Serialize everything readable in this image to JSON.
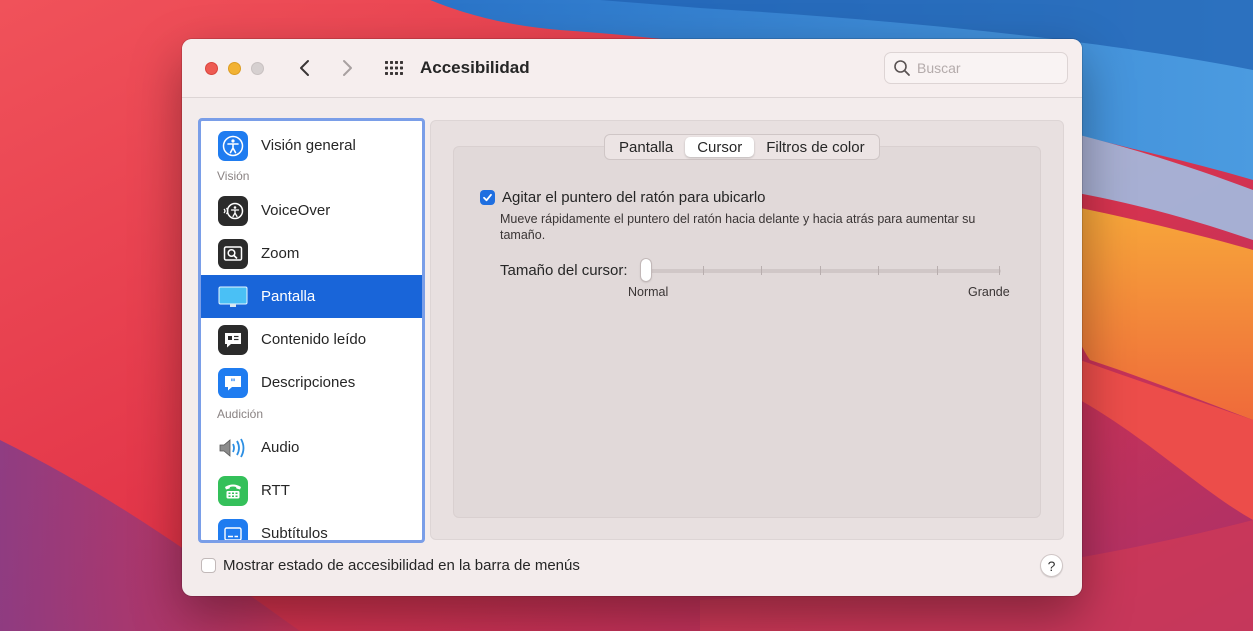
{
  "window": {
    "title": "Accesibilidad",
    "search_placeholder": "Buscar"
  },
  "sidebar": {
    "items": [
      {
        "label": "Visión general",
        "icon": "accessibility-icon"
      },
      {
        "label": "VoiceOver",
        "icon": "voiceover-icon"
      },
      {
        "label": "Zoom",
        "icon": "zoom-icon"
      },
      {
        "label": "Pantalla",
        "icon": "display-icon",
        "selected": true
      },
      {
        "label": "Contenido leído",
        "icon": "spoken-content-icon"
      },
      {
        "label": "Descripciones",
        "icon": "descriptions-icon"
      },
      {
        "label": "Audio",
        "icon": "speaker-icon"
      },
      {
        "label": "RTT",
        "icon": "rtt-phone-icon"
      },
      {
        "label": "Subtítulos",
        "icon": "subtitles-icon"
      }
    ],
    "sections": {
      "vision": "Visión",
      "audicion": "Audición"
    }
  },
  "tabs": [
    {
      "label": "Pantalla"
    },
    {
      "label": "Cursor",
      "active": true
    },
    {
      "label": "Filtros de color"
    }
  ],
  "cursor": {
    "shake_label": "Agitar el puntero del ratón para ubicarlo",
    "shake_checked": true,
    "shake_description": "Mueve rápidamente el puntero del ratón hacia delante y hacia atrás para aumentar su tamaño.",
    "size_label": "Tamaño del cursor:",
    "size_value": 0,
    "size_min_label": "Normal",
    "size_max_label": "Grande"
  },
  "footer": {
    "menu_status_label": "Mostrar estado de accesibilidad en la barra de menús",
    "menu_status_checked": false,
    "help_label": "?"
  },
  "colors": {
    "accent": "#1965d9",
    "sidebar_focus": "#7a9ee8"
  }
}
